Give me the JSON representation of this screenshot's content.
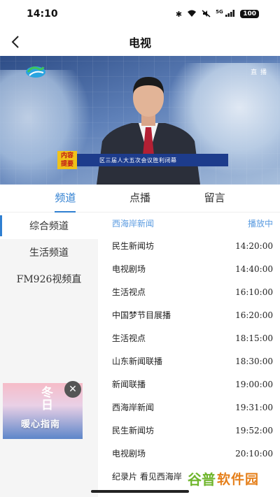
{
  "status_bar": {
    "time": "14:10",
    "signal_label": "5G",
    "battery": "100"
  },
  "nav": {
    "title": "电视"
  },
  "video": {
    "live_tag": "直 播",
    "tag_text": "内容\n提要",
    "headline": "区三届人大五次会议胜利闭幕"
  },
  "tabs": [
    {
      "label": "频道"
    },
    {
      "label": "点播"
    },
    {
      "label": "留言"
    }
  ],
  "channels": [
    {
      "label": "综合频道"
    },
    {
      "label": "生活频道"
    },
    {
      "label": "FM926视频直"
    }
  ],
  "promo": {
    "title": "冬日",
    "subtitle": "暖心指南"
  },
  "schedule": {
    "header": {
      "name": "西海岸新闻",
      "status": "播放中"
    },
    "rows": [
      {
        "name": "民生新闻坊",
        "time": "14:20:00"
      },
      {
        "name": "电视剧场",
        "time": "14:40:00"
      },
      {
        "name": "生活视点",
        "time": "16:10:00"
      },
      {
        "name": "中国梦节目展播",
        "time": "16:20:00"
      },
      {
        "name": "生活视点",
        "time": "18:15:00"
      },
      {
        "name": "山东新闻联播",
        "time": "18:30:00"
      },
      {
        "name": "新闻联播",
        "time": "19:00:00"
      },
      {
        "name": "西海岸新闻",
        "time": "19:31:00"
      },
      {
        "name": "民生新闻坊",
        "time": "19:52:00"
      },
      {
        "name": "电视剧场",
        "time": "20:10:00"
      },
      {
        "name": "纪录片 看见西海岸",
        "time": ""
      }
    ]
  },
  "watermark": {
    "logo": "谷普",
    "text": "软件园"
  },
  "colors": {
    "accent": "#2f7fd1",
    "schedule_header": "#5a9be0",
    "sidebar_bg": "#f5f5f5"
  }
}
